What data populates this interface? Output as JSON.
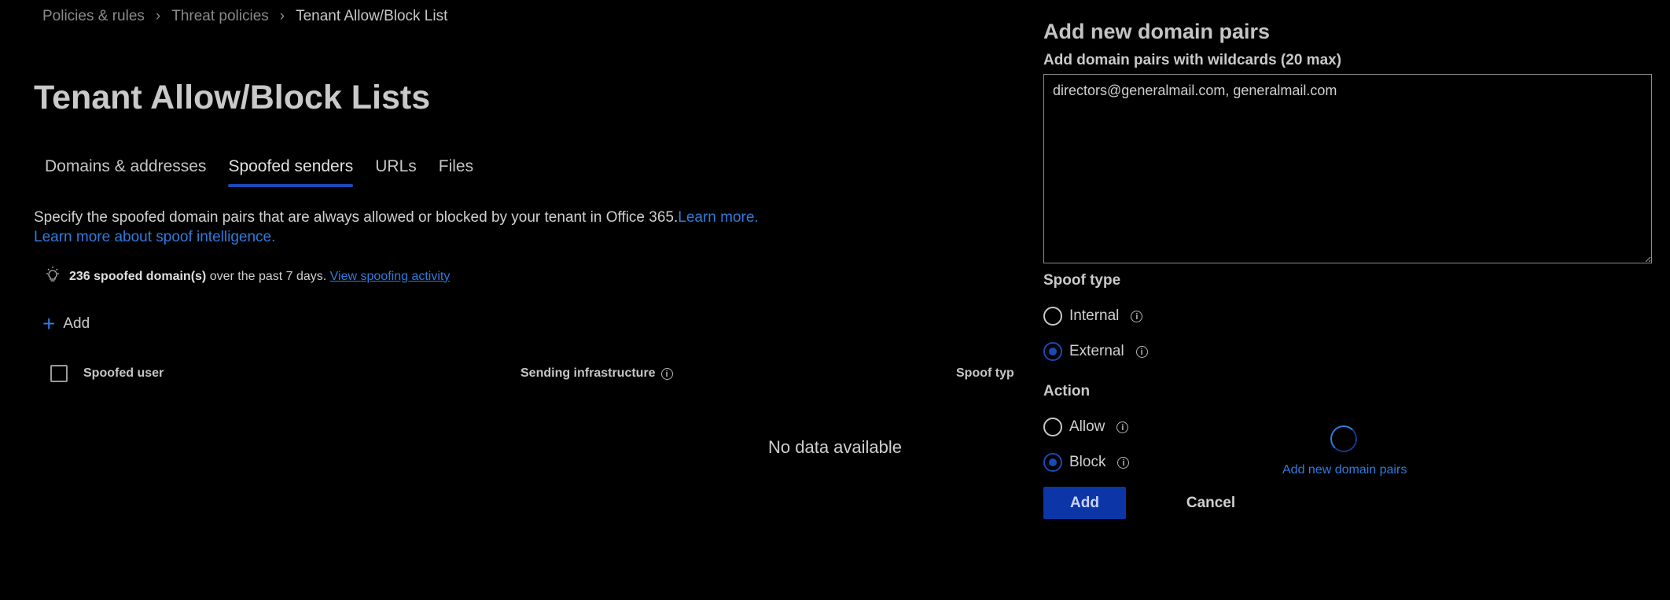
{
  "breadcrumb": {
    "items": [
      "Policies & rules",
      "Threat policies"
    ],
    "current": "Tenant Allow/Block List"
  },
  "page": {
    "title": "Tenant Allow/Block Lists"
  },
  "tabs": [
    {
      "label": "Domains & addresses",
      "active": false
    },
    {
      "label": "Spoofed senders",
      "active": true
    },
    {
      "label": "URLs",
      "active": false
    },
    {
      "label": "Files",
      "active": false
    }
  ],
  "description": {
    "text": "Specify the spoofed domain pairs that are always allowed or blocked by your tenant in Office 365.",
    "learn_more": "Learn more.",
    "spoof_link": "Learn more about spoof intelligence."
  },
  "insight": {
    "icon": "lightbulb-icon",
    "count": "236 spoofed domain(s)",
    "text": " over the past 7 days. ",
    "link": "View spoofing activity"
  },
  "commands": {
    "add_label": "Add"
  },
  "table": {
    "columns": [
      "Spoofed user",
      "Sending infrastructure",
      "Spoof typ"
    ],
    "empty_text": "No data available"
  },
  "panel": {
    "title": "Add new domain pairs",
    "input_label": "Add domain pairs with wildcards (20 max)",
    "input_value": "directors@generalmail.com, generalmail.com",
    "spoof_type_label": "Spoof type",
    "spoof_types": [
      {
        "label": "Internal",
        "selected": false
      },
      {
        "label": "External",
        "selected": true
      }
    ],
    "action_label": "Action",
    "actions": [
      {
        "label": "Allow",
        "selected": false
      },
      {
        "label": "Block",
        "selected": true
      }
    ],
    "add_button": "Add",
    "cancel_button": "Cancel",
    "loading_text": "Add new domain pairs"
  },
  "colors": {
    "accent": "#1a4ab8",
    "link": "#2f7bdc",
    "background": "#000000"
  }
}
